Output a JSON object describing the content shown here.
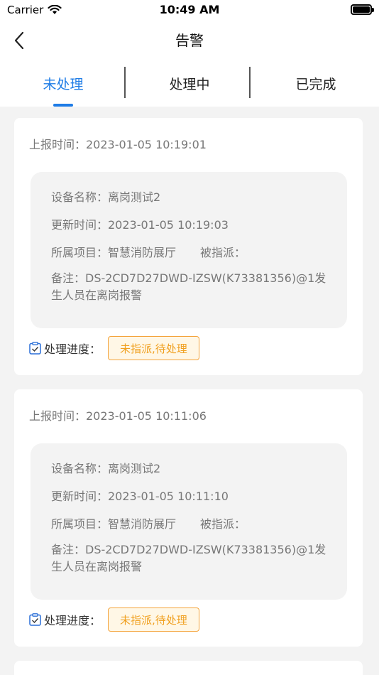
{
  "status_bar": {
    "carrier": "Carrier",
    "time": "10:49 AM"
  },
  "nav": {
    "title": "告警"
  },
  "tabs": [
    {
      "label": "未处理",
      "active": true
    },
    {
      "label": "处理中",
      "active": false
    },
    {
      "label": "已完成",
      "active": false
    }
  ],
  "alerts": [
    {
      "report_time": "上报时间：2023-01-05 10:19:01",
      "device": "设备名称：离岗测试2",
      "update_time": "更新时间：2023-01-05 10:19:03",
      "project": "所属项目：智慧消防展厅",
      "assignee": "被指派：",
      "remark": "备注：DS-2CD7D27DWD-IZSW(K73381356)@1发生人员在离岗报警",
      "progress_label": "处理进度：",
      "status": "未指派,待处理"
    },
    {
      "report_time": "上报时间：2023-01-05 10:11:06",
      "device": "设备名称：离岗测试2",
      "update_time": "更新时间：2023-01-05 10:11:10",
      "project": "所属项目：智慧消防展厅",
      "assignee": "被指派：",
      "remark": "备注：DS-2CD7D27DWD-IZSW(K73381356)@1发生人员在离岗报警",
      "progress_label": "处理进度：",
      "status": "未指派,待处理"
    }
  ],
  "colors": {
    "accent": "#1e7ce6",
    "badge_border": "#f4a33a",
    "badge_text": "#f0a020"
  },
  "icons": {
    "back": "chevron-left-icon",
    "progress": "clipboard-icon",
    "wifi": "wifi-icon",
    "battery": "battery-icon"
  }
}
